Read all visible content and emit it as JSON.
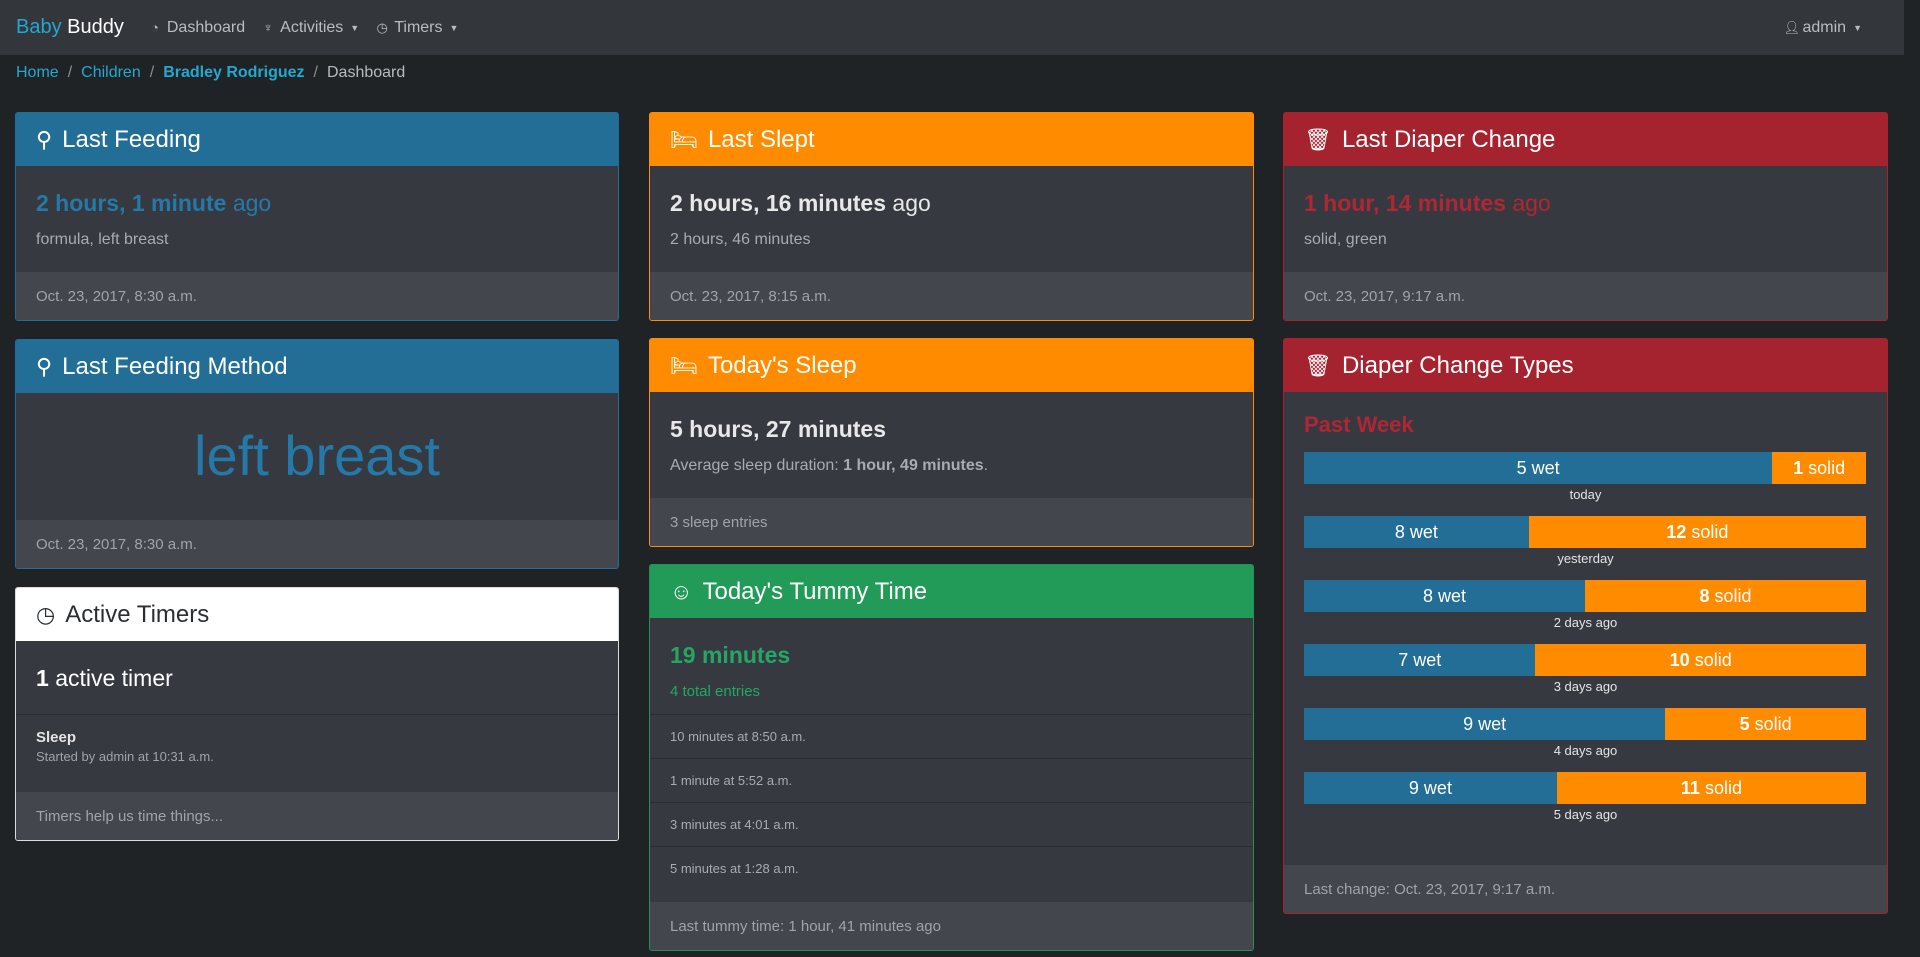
{
  "nav": {
    "brand_part1": "Baby",
    "brand_part2": "Buddy",
    "dashboard": "Dashboard",
    "activities": "Activities",
    "timers": "Timers",
    "user": "admin"
  },
  "breadcrumb": {
    "home": "Home",
    "children": "Children",
    "child": "Bradley Rodriguez",
    "current": "Dashboard"
  },
  "last_feeding": {
    "title": "Last Feeding",
    "time": "2 hours, 1 minute",
    "suffix": "ago",
    "details": "formula, left breast",
    "footer": "Oct. 23, 2017, 8:30 a.m."
  },
  "last_feeding_method": {
    "title": "Last Feeding Method",
    "method": "left breast",
    "footer": "Oct. 23, 2017, 8:30 a.m."
  },
  "active_timers": {
    "title": "Active Timers",
    "count": "1",
    "count_label": "active timer",
    "timer_name": "Sleep",
    "timer_started": "Started by admin at 10:31 a.m.",
    "footer": "Timers help us time things..."
  },
  "last_slept": {
    "title": "Last Slept",
    "time": "2 hours, 16 minutes",
    "suffix": "ago",
    "duration": "2 hours, 46 minutes",
    "footer": "Oct. 23, 2017, 8:15 a.m."
  },
  "todays_sleep": {
    "title": "Today's Sleep",
    "total": "5 hours, 27 minutes",
    "avg_prefix": "Average sleep duration: ",
    "avg_value": "1 hour, 49 minutes",
    "avg_suffix": ".",
    "footer": "3 sleep entries"
  },
  "tummy_time": {
    "title": "Today's Tummy Time",
    "total": "19 minutes",
    "entries": "4 total entries",
    "items": [
      "10 minutes at 8:50 a.m.",
      "1 minute at 5:52 a.m.",
      "3 minutes at 4:01 a.m.",
      "5 minutes at 1:28 a.m."
    ],
    "footer": "Last tummy time: 1 hour, 41 minutes ago"
  },
  "last_diaper": {
    "title": "Last Diaper Change",
    "time": "1 hour, 14 minutes",
    "suffix": "ago",
    "details": "solid, green",
    "footer": "Oct. 23, 2017, 9:17 a.m."
  },
  "diaper_types": {
    "title": "Diaper Change Types",
    "period": "Past Week",
    "wet_word": "wet",
    "solid_word": "solid",
    "rows": [
      {
        "label": "today",
        "wet": 5,
        "solid": 1
      },
      {
        "label": "yesterday",
        "wet": 8,
        "solid": 12
      },
      {
        "label": "2 days ago",
        "wet": 8,
        "solid": 8
      },
      {
        "label": "3 days ago",
        "wet": 7,
        "solid": 10
      },
      {
        "label": "4 days ago",
        "wet": 9,
        "solid": 5
      },
      {
        "label": "5 days ago",
        "wet": 9,
        "solid": 11
      }
    ],
    "footer": "Last change: Oct. 23, 2017, 9:17 a.m."
  },
  "colors": {
    "feeding": "#226e97",
    "sleep": "#ff8c00",
    "diaper": "#a4232e",
    "tummy": "#229a58",
    "brand": "#24a8cf"
  },
  "icons": {
    "feeding": "spoon-icon",
    "sleep": "bed-icon",
    "diaper": "trash-icon",
    "timer": "clock-icon",
    "tummy": "smile-icon"
  }
}
